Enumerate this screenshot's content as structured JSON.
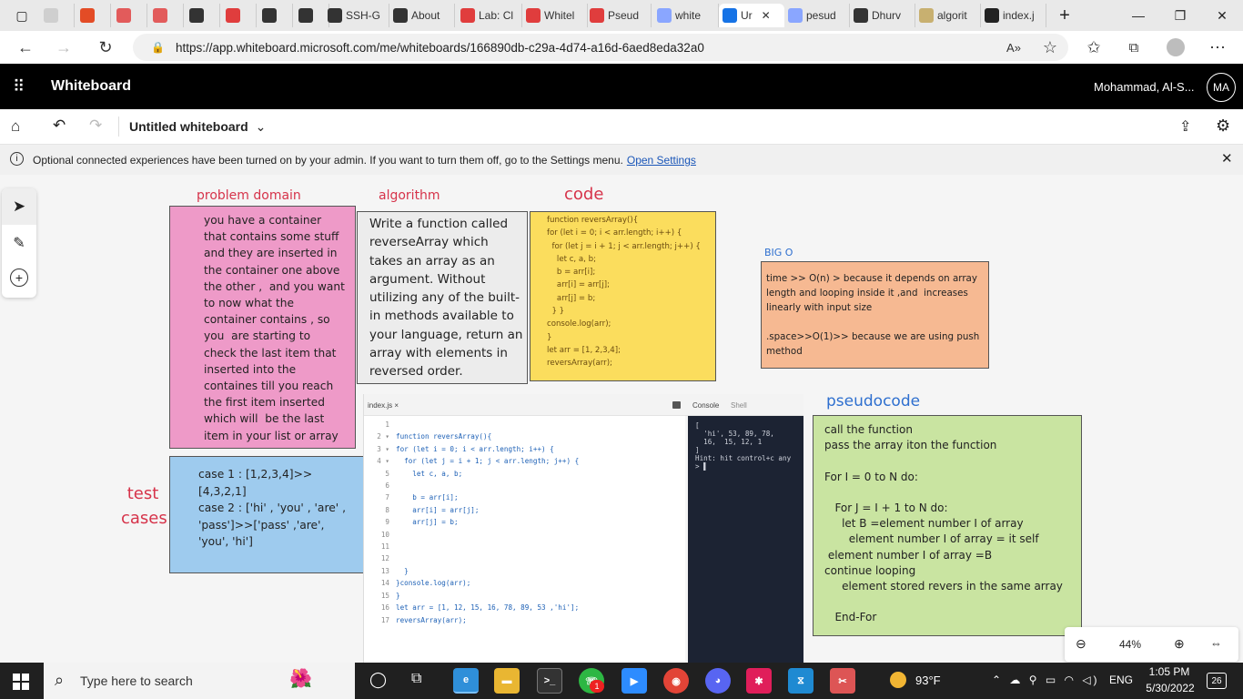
{
  "browser": {
    "tabs": [
      {
        "label": "",
        "color": "#cfcfcf"
      },
      {
        "label": "",
        "color": "#e34c26"
      },
      {
        "label": "",
        "color": "#e25b5b"
      },
      {
        "label": "",
        "color": "#e25b5b"
      },
      {
        "label": "",
        "color": "#333333"
      },
      {
        "label": "",
        "color": "#e03d3d"
      },
      {
        "label": "",
        "color": "#333333"
      },
      {
        "label": "",
        "color": "#333333"
      },
      {
        "label": "",
        "color": "#8c5ab0"
      },
      {
        "label": "SSH-G",
        "color": "#333333"
      },
      {
        "label": "About",
        "color": "#333333"
      },
      {
        "label": "Lab: Cl",
        "color": "#e03d3d"
      },
      {
        "label": "Whitel",
        "color": "#e03d3d"
      },
      {
        "label": "Pseud",
        "color": "#e03d3d"
      },
      {
        "label": "white",
        "color": "#8aa6ff"
      },
      {
        "label": "Ur",
        "color": "#1673e6"
      },
      {
        "label": "pesud",
        "color": "#8aa6ff"
      },
      {
        "label": "Dhurv",
        "color": "#333333"
      },
      {
        "label": "algorit",
        "color": "#c8b070"
      },
      {
        "label": "index.j",
        "color": "#222222"
      }
    ],
    "url": "https://app.whiteboard.microsoft.com/me/whiteboards/166890db-c29a-4d74-a16d-6aed8eda32a0",
    "read_aloud": "A»"
  },
  "app": {
    "name": "Whiteboard",
    "user_name": "Mohammad, Al-S...",
    "user_initials": "MA",
    "board_title": "Untitled whiteboard",
    "info_text": "Optional connected experiences have been turned on by your admin. If you want to turn them off, go to the Settings menu.",
    "info_link": "Open Settings",
    "zoom": "44%"
  },
  "board": {
    "problem_domain": {
      "title": "problem domain",
      "lines": [
        "you have a container",
        "that contains some stuff",
        "and they are inserted in",
        "the container one above",
        "the other ,  and you want",
        "to now what the",
        "container contains , so",
        "you  are starting to",
        "check the last item that",
        "inserted into the",
        "containes till you reach",
        "the first item inserted",
        "which will  be the last",
        "item in your list or array"
      ]
    },
    "algorithm": {
      "title": "algorithm",
      "lines": [
        "Write a function called",
        "reverseArray which",
        "takes an array as an",
        "argument. Without",
        "utilizing any of the built-",
        "in methods available to",
        "your language, return an",
        "array with elements in",
        "reversed order."
      ]
    },
    "code": {
      "title": "code",
      "lines": [
        "function reversArray(){",
        "for (let i = 0; i < arr.length; i++) {",
        "  for (let j = i + 1; j < arr.length; j++) {",
        "    let c, a, b;",
        "    b = arr[i];",
        "    arr[i] = arr[j];",
        "    arr[j] = b;",
        "  } }",
        "console.log(arr);",
        "}",
        "let arr = [1, 2,3,4];",
        "reversArray(arr);"
      ]
    },
    "bigo": {
      "title": "BIG O",
      "lines": [
        "time >> O(n) > because it depends on array",
        "length and looping inside it ,and  increases",
        "linearly with input size",
        "",
        ".space>>O(1)>> because we are using push",
        "method"
      ]
    },
    "test_cases": {
      "title_line1": "test",
      "title_line2": "cases",
      "lines": [
        "case 1 : [1,2,3,4]>>",
        "[4,3,2,1]",
        "case 2 : ['hi' , 'you' , 'are' ,",
        "'pass']>>['pass' ,'are',",
        "'you', 'hi']"
      ]
    },
    "editor": {
      "tab_label": "index.js ×",
      "console_tab": "Console",
      "shell_tab": "Shell",
      "line_numbers": [
        "1",
        "2 ▾",
        "3 ▾",
        "4 ▾",
        "5",
        "6",
        "7",
        "8",
        "9",
        "10",
        "11",
        "12",
        "13",
        "14",
        "15",
        "16",
        "17"
      ],
      "lines": [
        "",
        "function reversArray(){",
        "for (let i = 0; i < arr.length; i++) {",
        "  for (let j = i + 1; j < arr.length; j++) {",
        "    let c, a, b;",
        "",
        "    b = arr[i];",
        "    arr[i] = arr[j];",
        "    arr[j] = b;",
        "",
        "",
        "",
        "  }",
        "}console.log(arr);",
        "}",
        "let arr = [1, 12, 15, 16, 78, 89, 53 ,'hi'];",
        "reversArray(arr);"
      ],
      "console_lines": [
        "[",
        "  'hi', 53, 89, 78,",
        "  16,  15, 12, 1",
        "]",
        "Hint: hit control+c any",
        "> ▌"
      ]
    },
    "pseudocode": {
      "title": "pseudocode",
      "lines": [
        "call the function",
        "pass the array iton the function",
        "",
        "For I = 0 to N do:",
        "",
        "   For J = I + 1 to N do:",
        "     let B =element number I of array",
        "       element number I of array = it self",
        " element number I of array =B",
        "continue looping",
        "     element stored revers in the same array",
        "",
        "   End-For"
      ]
    }
  },
  "taskbar": {
    "search_placeholder": "Type here to search",
    "temperature": "93°F",
    "language": "ENG",
    "time": "1:05 PM",
    "date": "5/30/2022",
    "notification_count": "26",
    "whatsapp_badge": "1"
  },
  "colors": {
    "pink": "#ee9ac8",
    "gray": "#ececec",
    "yellow": "#fbdd5d",
    "orange": "#f6b992",
    "blue": "#9ecbee",
    "green": "#c9e4a1",
    "handwriting_red": "#d6334a",
    "handwriting_blue": "#2e6fcf"
  }
}
